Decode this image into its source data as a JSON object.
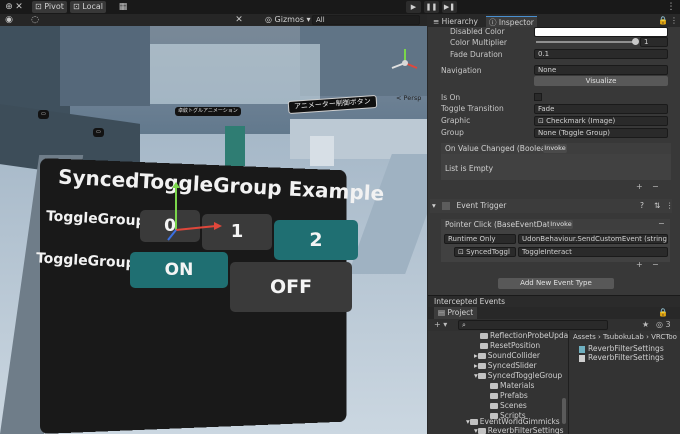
{
  "toolbar": {
    "pivot_label": "Pivot",
    "local_label": "Local",
    "gizmos_label": "Gizmos",
    "search_placeholder": "All"
  },
  "scene": {
    "persp_label": "< Persp",
    "signs": {
      "small": "卓紋トグルアニメーション",
      "big": "アニメーター制御ボタン"
    },
    "panel": {
      "title": "SyncedToggleGroup Example",
      "row1_label": "ToggleGroup",
      "row2_label": "ToggleGroup",
      "btn_0": "0",
      "btn_1": "1",
      "btn_2": "2",
      "btn_on": "ON",
      "btn_off": "OFF"
    }
  },
  "tabs": {
    "hierarchy": "Hierarchy",
    "inspector": "Inspector"
  },
  "inspector": {
    "disabled_color_label": "Disabled Color",
    "color_multiplier_label": "Color Multiplier",
    "color_multiplier_value": "1",
    "color_multiplier_fraction": 1.0,
    "fade_duration_label": "Fade Duration",
    "fade_duration_value": "0.1",
    "navigation_label": "Navigation",
    "navigation_value": "None",
    "visualize_label": "Visualize",
    "is_on_label": "Is On",
    "toggle_transition_label": "Toggle Transition",
    "toggle_transition_value": "Fade",
    "graphic_label": "Graphic",
    "graphic_value": "Checkmark (Image)",
    "group_label": "Group",
    "group_value": "None (Toggle Group)",
    "on_value_changed_label": "On Value Changed (Boolean)",
    "invoke_label": "Invoke",
    "list_empty": "List is Empty",
    "event_trigger_label": "Event Trigger",
    "pointer_click_label": "Pointer Click (BaseEventData)",
    "invoke_label_2": "Invoke",
    "runtime_label": "Runtime Only",
    "function_label": "UdonBehaviour.SendCustomEvent (string)",
    "target_object": "SyncedToggl",
    "argument_value": "ToggleInteract",
    "add_event_type_label": "Add New Event Type",
    "intercepted_events_label": "Intercepted Events",
    "plus": "+",
    "minus": "−"
  },
  "project": {
    "tab_label": "Project",
    "breadcrumb": [
      "Assets",
      "TsubokuLab",
      "VRCToo"
    ],
    "tree": [
      {
        "label": "ReflectionProbeUpda",
        "indent": 1
      },
      {
        "label": "ResetPosition",
        "indent": 1
      },
      {
        "label": "SoundCollider",
        "indent": 1
      },
      {
        "label": "SyncedSlider",
        "indent": 1
      },
      {
        "label": "SyncedToggleGroup",
        "indent": 1
      },
      {
        "label": "Materials",
        "indent": 2
      },
      {
        "label": "Prefabs",
        "indent": 2
      },
      {
        "label": "Scenes",
        "indent": 2
      },
      {
        "label": "Scripts",
        "indent": 2
      },
      {
        "label": "EventWorldGimmicks",
        "indent": 0
      },
      {
        "label": "ReverbFilterSettings",
        "indent": 1
      }
    ],
    "assets": [
      "ReverbFilterSettings",
      "ReverbFilterSettings"
    ],
    "count_label": "3"
  },
  "colors": {
    "teal_button": "#1f6f72",
    "dark_button": "#3a3a3a",
    "panel_bg": "#191919",
    "editor_bg": "#282828"
  }
}
